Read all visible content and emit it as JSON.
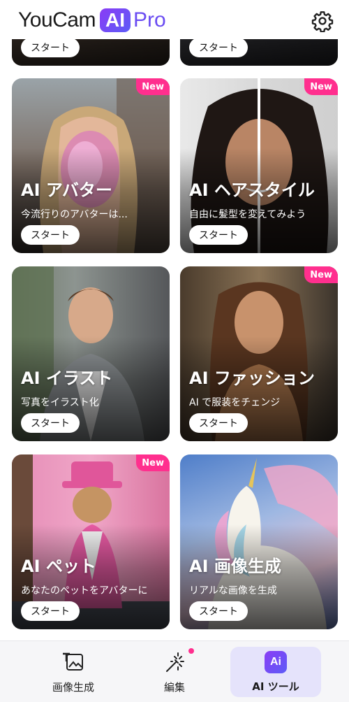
{
  "header": {
    "logo_word": "YouCam",
    "logo_ai": "AI",
    "logo_pro": "Pro",
    "settings_icon": "gear-icon"
  },
  "cards": [
    {
      "title": "",
      "subtitle": "",
      "start": "スタート",
      "badge": ""
    },
    {
      "title": "",
      "subtitle": "",
      "start": "スタート",
      "badge": ""
    },
    {
      "title": "AI アバター",
      "subtitle": "今流行りのアバターは...",
      "start": "スタート",
      "badge": "New"
    },
    {
      "title": "AI ヘアスタイル",
      "subtitle": "自由に髪型を変えてみよう",
      "start": "スタート",
      "badge": "New"
    },
    {
      "title": "AI イラスト",
      "subtitle": "写真をイラスト化",
      "start": "スタート",
      "badge": ""
    },
    {
      "title": "AI ファッション",
      "subtitle": "AI で服装をチェンジ",
      "start": "スタート",
      "badge": "New"
    },
    {
      "title": "AI ペット",
      "subtitle": "あなたのペットをアバターに",
      "start": "スタート",
      "badge": "New"
    },
    {
      "title": "AI 画像生成",
      "subtitle": "リアルな画像を生成",
      "start": "スタート",
      "badge": ""
    }
  ],
  "nav": {
    "items": [
      {
        "label": "画像生成",
        "icon": "text-to-image-icon"
      },
      {
        "label": "編集",
        "icon": "magic-wand-icon"
      },
      {
        "label": "AI ツール",
        "icon": "ai-tools-icon",
        "active": true
      }
    ]
  },
  "colors": {
    "accent": "#6a4cf2",
    "badge": "#ff2f8e",
    "nav_active_bg": "#e5e3fb"
  }
}
